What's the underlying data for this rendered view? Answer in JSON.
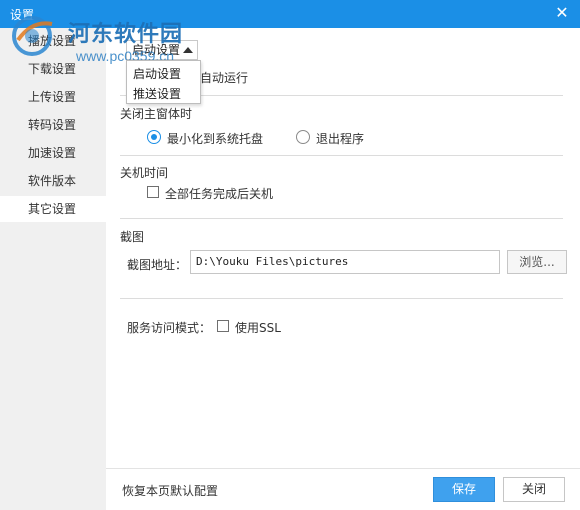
{
  "window": {
    "title": "设置",
    "close_glyph": "✕"
  },
  "watermark": {
    "site_name": "河东软件园",
    "url": "www.pc0359.cn"
  },
  "sidebar": {
    "items": [
      {
        "label": "播放设置"
      },
      {
        "label": "下载设置"
      },
      {
        "label": "上传设置"
      },
      {
        "label": "转码设置"
      },
      {
        "label": "加速设置"
      },
      {
        "label": "软件版本"
      },
      {
        "label": "其它设置"
      }
    ],
    "active_index": 6
  },
  "startup": {
    "selected": "启动设置",
    "options": [
      "启动设置",
      "推送设置"
    ],
    "partial_label": "自动运行"
  },
  "close_main": {
    "title": "关闭主窗体时",
    "options": [
      {
        "label": "最小化到系统托盘",
        "checked": true
      },
      {
        "label": "退出程序",
        "checked": false
      }
    ]
  },
  "shutdown": {
    "title": "关机时间",
    "checkbox_label": "全部任务完成后关机",
    "checked": false
  },
  "screenshot": {
    "title": "截图",
    "path_label": "截图地址：",
    "path_value": "D:\\Youku Files\\pictures",
    "browse_label": "浏览..."
  },
  "service": {
    "mode_label": "服务访问模式：",
    "ssl_label": "使用SSL",
    "ssl_checked": false
  },
  "footer": {
    "restore_label": "恢复本页默认配置",
    "save_label": "保存",
    "close_label": "关闭"
  },
  "colors": {
    "accent": "#1b8fe6",
    "save_button": "#3fa1ee",
    "sidebar_bg": "#f0f0f0"
  }
}
